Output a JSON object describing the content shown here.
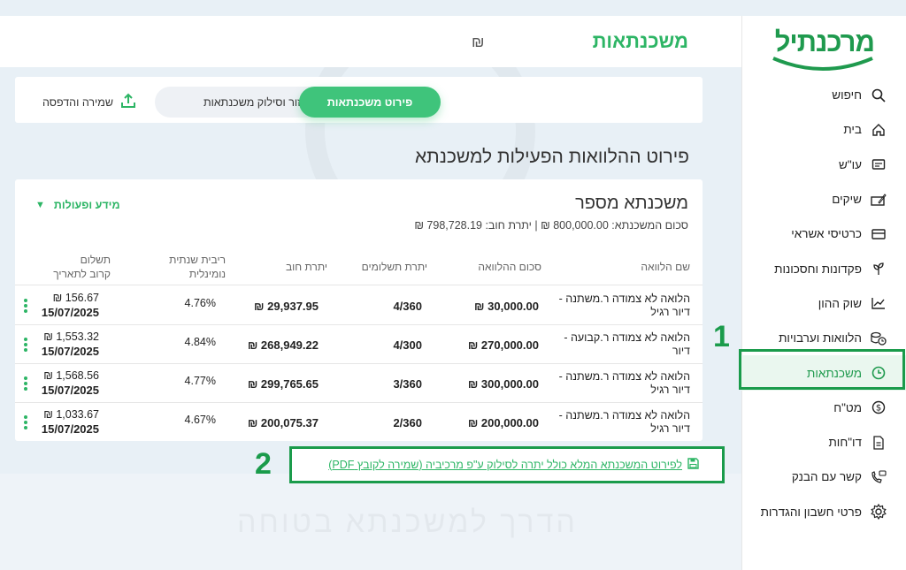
{
  "app": {
    "title": "משכנתאות",
    "currency_symbol": "₪",
    "logo_text": "מרכנתיל",
    "accent_color": "#2db565",
    "brand_color": "#1f9a4e"
  },
  "sidebar": {
    "items": [
      {
        "label": "חיפוש",
        "icon": "search-icon"
      },
      {
        "label": "בית",
        "icon": "home-icon"
      },
      {
        "label": "עו\"ש",
        "icon": "account-icon"
      },
      {
        "label": "שיקים",
        "icon": "cheque-icon"
      },
      {
        "label": "כרטיסי אשראי",
        "icon": "credit-card-icon"
      },
      {
        "label": "פקדונות וחסכונות",
        "icon": "plant-icon"
      },
      {
        "label": "שוק ההון",
        "icon": "chart-icon"
      },
      {
        "label": "הלוואות וערבויות",
        "icon": "coins-clock-icon"
      },
      {
        "label": "משכנתאות",
        "icon": "clock-icon",
        "active": true
      },
      {
        "label": "מט\"ח",
        "icon": "dollar-icon"
      },
      {
        "label": "דו\"חות",
        "icon": "report-icon"
      },
      {
        "label": "קשר עם הבנק",
        "icon": "phone-chat-icon"
      },
      {
        "label": "פרטי חשבון והגדרות",
        "icon": "gear-icon"
      }
    ]
  },
  "markers": {
    "one": "1",
    "two": "2"
  },
  "tabs": {
    "active": "פירוט משכנתאות",
    "inactive": "מיחזור וסילוק משכנתאות",
    "save_print": "שמירה והדפסה"
  },
  "section_title": "פירוט ההלוואות הפעילות למשכנתא",
  "mortgage": {
    "title": "משכנתא מספר",
    "summary": "סכום המשכנתא: 800,000.00 ₪ | יתרת חוב: 798,728.19 ₪",
    "info_actions": "מידע ופעולות"
  },
  "table": {
    "headers": {
      "name": "שם הלוואה",
      "amount": "סכום ההלוואה",
      "remaining_payments": "יתרת תשלומים",
      "balance": "יתרת חוב",
      "rate_line1": "ריבית שנתית",
      "rate_line2": "נומינלית",
      "next_line1": "תשלום",
      "next_line2": "קרוב לתאריך"
    },
    "rows": [
      {
        "name": "הלואה לא צמודה ר.משתנה - דיור רגיל",
        "amount": "30,000.00 ₪",
        "payments": "4/360",
        "balance": "29,937.95 ₪",
        "rate": "4.76%",
        "payment": "156.67 ₪",
        "date": "15/07/2025"
      },
      {
        "name": "הלואה לא צמודה ר.קבועה - דיור",
        "amount": "270,000.00 ₪",
        "payments": "4/300",
        "balance": "268,949.22 ₪",
        "rate": "4.84%",
        "payment": "1,553.32 ₪",
        "date": "15/07/2025"
      },
      {
        "name": "הלואה לא צמודה ר.משתנה - דיור רגיל",
        "amount": "300,000.00 ₪",
        "payments": "3/360",
        "balance": "299,765.65 ₪",
        "rate": "4.77%",
        "payment": "1,568.56 ₪",
        "date": "15/07/2025"
      },
      {
        "name": "הלואה לא צמודה ר.משתנה - דיור רגיל",
        "amount": "200,000.00 ₪",
        "payments": "2/360",
        "balance": "200,075.37 ₪",
        "rate": "4.67%",
        "payment": "1,033.67 ₪",
        "date": "15/07/2025"
      }
    ]
  },
  "pdf_link": "לפירוט המשכנתא המלא כולל יתרה לסילוק ע\"פ מרכיביה (שמירה לקובץ PDF)",
  "watermark": "הדרך למשכנתא בטוחה"
}
